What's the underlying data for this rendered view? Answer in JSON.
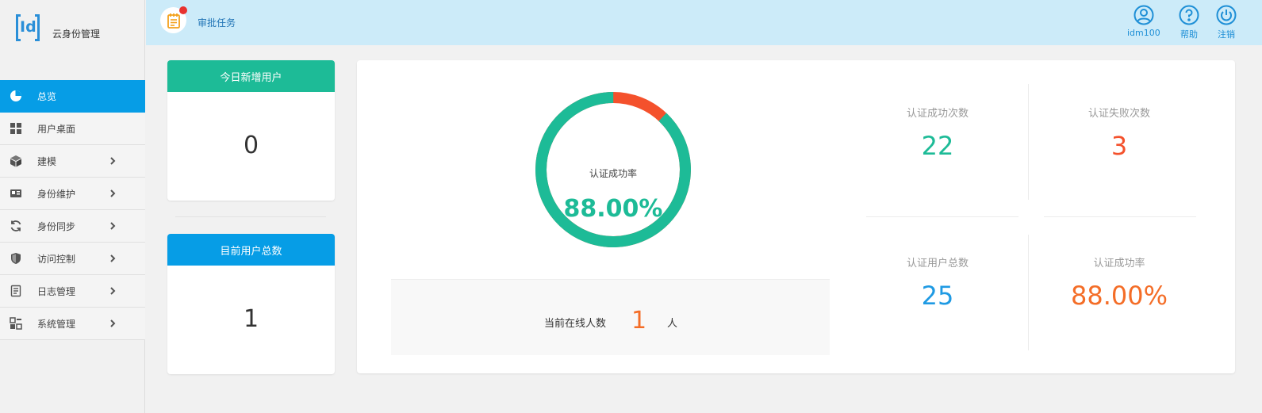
{
  "app": {
    "logo_text": "Id",
    "name": "云身份管理"
  },
  "sidebar": {
    "items": [
      {
        "label": "总览",
        "icon": "pie-chart-icon",
        "active": true,
        "has_submenu": false
      },
      {
        "label": "用户桌面",
        "icon": "grid-icon",
        "active": false,
        "has_submenu": false
      },
      {
        "label": "建模",
        "icon": "cube-icon",
        "active": false,
        "has_submenu": true
      },
      {
        "label": "身份维护",
        "icon": "id-card-icon",
        "active": false,
        "has_submenu": true
      },
      {
        "label": "身份同步",
        "icon": "sync-icon",
        "active": false,
        "has_submenu": true
      },
      {
        "label": "访问控制",
        "icon": "shield-icon",
        "active": false,
        "has_submenu": true
      },
      {
        "label": "日志管理",
        "icon": "document-icon",
        "active": false,
        "has_submenu": true
      },
      {
        "label": "系统管理",
        "icon": "apps-icon",
        "active": false,
        "has_submenu": true
      }
    ]
  },
  "topbar": {
    "task_label": "审批任务",
    "user_label": "idm100",
    "help_label": "帮助",
    "logout_label": "注销"
  },
  "cards": {
    "new_users": {
      "title": "今日新增用户",
      "value": "0"
    },
    "total_users": {
      "title": "目前用户总数",
      "value": "1"
    }
  },
  "donut": {
    "title": "认证成功率",
    "value_text": "88.00%",
    "success_fraction": 0.88
  },
  "online": {
    "label": "当前在线人数",
    "value": "1",
    "unit": "人"
  },
  "stats": {
    "success_count": {
      "title": "认证成功次数",
      "value": "22"
    },
    "fail_count": {
      "title": "认证失败次数",
      "value": "3"
    },
    "user_total": {
      "title": "认证用户总数",
      "value": "25"
    },
    "success_rate": {
      "title": "认证成功率",
      "value": "88.00%"
    }
  },
  "colors": {
    "accent_blue": "#069de6",
    "green": "#1dbb97",
    "red": "#f4512c",
    "orange": "#f46d27",
    "stat_blue": "#1f9ae3"
  }
}
